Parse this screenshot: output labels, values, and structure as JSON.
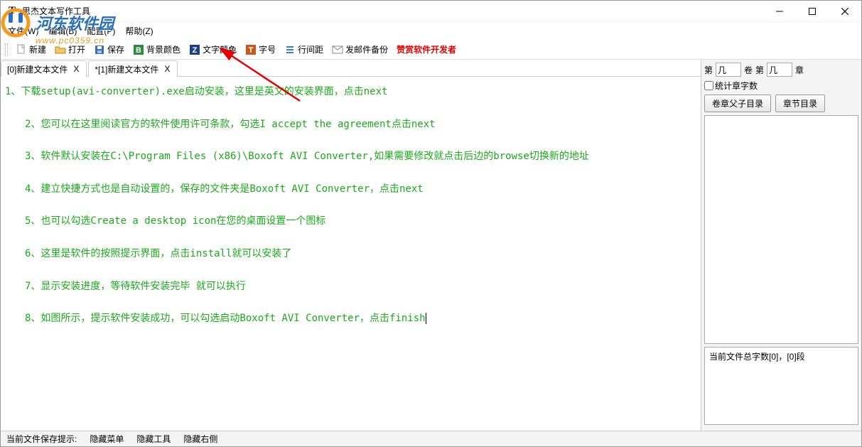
{
  "titlebar": {
    "app_icon": "T",
    "title": "思杰文本写作工具"
  },
  "watermark": {
    "name": "河东软件园",
    "url": "www.pc0359.cn"
  },
  "menubar": {
    "file": "文件(W)",
    "edit": "编辑(B)",
    "config": "配置(P)",
    "help": "帮助(Z)"
  },
  "toolbar": {
    "new_label": "新建",
    "open_label": "打开",
    "save_label": "保存",
    "bgcolor_label": "背景颜色",
    "textcolor_label": "文字颜色",
    "font_label": "字号",
    "spacing_label": "行间距",
    "email_label": "发邮件备份",
    "donate_label": "赞赏软件开发者"
  },
  "tabs": [
    {
      "label": "[0]新建文本文件",
      "close": "X"
    },
    {
      "label": "*[1]新建文本文件",
      "close": "X"
    }
  ],
  "editor_lines": [
    "1、下载setup(avi-converter).exe启动安装，这里是英文的安装界面，点击next",
    "2、您可以在这里阅读官方的软件使用许可条款，勾选I accept the agreement点击next",
    "3、软件默认安装在C:\\Program Files (x86)\\Boxoft AVI Converter,如果需要修改就点击后边的browse切换新的地址",
    "4、建立快捷方式也是自动设置的，保存的文件夹是Boxoft AVI Converter，点击next",
    "5、也可以勾选Create a desktop icon在您的桌面设置一个图标",
    "6、这里是软件的按照提示界面，点击install就可以安装了",
    "7、显示安装进度，等待软件安装完毕 就可以执行",
    "8、如图所示，提示软件安装成功，可以勾选启动Boxoft AVI Converter，点击finish"
  ],
  "side": {
    "prefix_vol": "第",
    "vol_val": "几",
    "suffix_vol": "卷",
    "prefix_ch": "第",
    "ch_val": "几",
    "suffix_ch": "章",
    "stat_label": "统计章字数",
    "btn_parent": "卷章父子目录",
    "btn_chapter": "章节目录",
    "stats_text": "当前文件总字数[0]，[0]段"
  },
  "statusbar": {
    "save_hint": "当前文件保存提示:",
    "hide_menu": "隐藏菜单",
    "hide_tool": "隐藏工具",
    "hide_right": "隐藏右侧"
  }
}
